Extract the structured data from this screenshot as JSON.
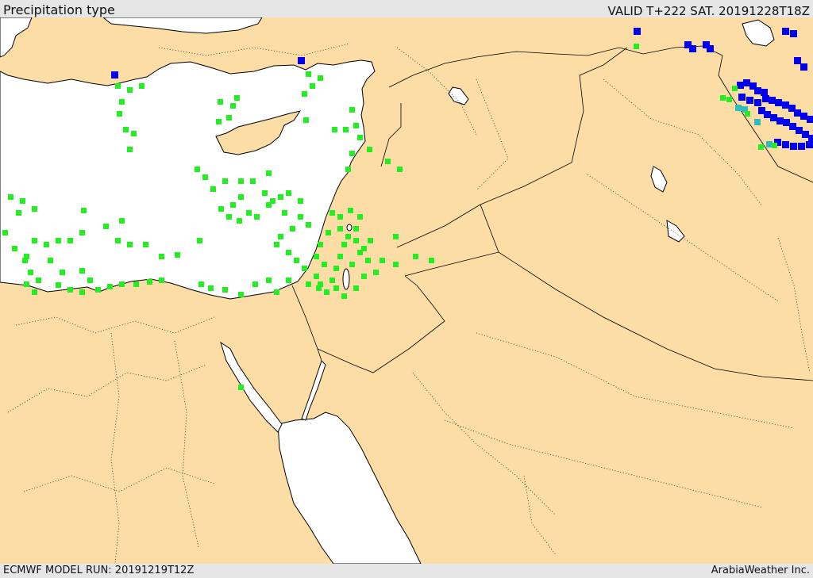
{
  "header": {
    "title": "Precipitation type",
    "valid_time": "VALID T+222 SAT. 20191228T18Z"
  },
  "footer": {
    "model_run": "ECMWF MODEL RUN: 20191219T12Z",
    "credit": "ArabiaWeather Inc."
  },
  "colors": {
    "land": "#fcdda6",
    "sea": "#ffffff",
    "rain": "#22ee22",
    "snow": "#0000ee",
    "mixed": "#33bbbb",
    "header_bg": "#e6e6e6",
    "border": "#000000"
  }
}
